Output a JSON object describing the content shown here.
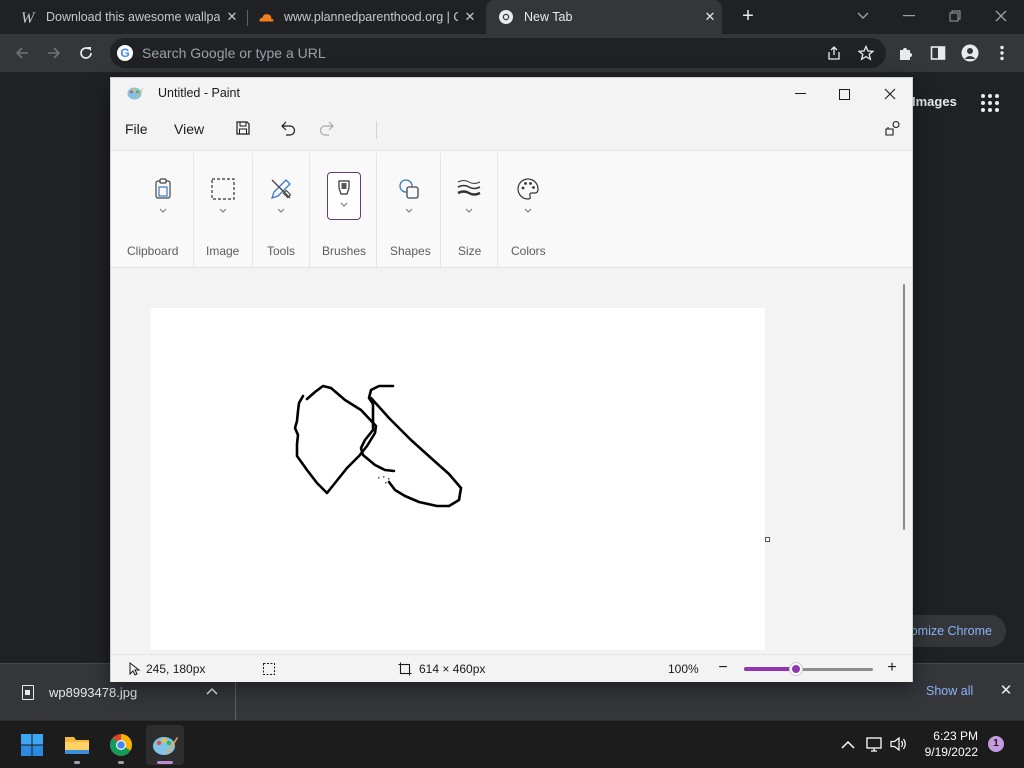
{
  "chrome": {
    "tabs": [
      {
        "title": "Download this awesome wallpap",
        "icon": "wallpaper-site-icon"
      },
      {
        "title": "www.plannedparenthood.org | C",
        "icon": "cloudflare-icon"
      },
      {
        "title": "New Tab",
        "icon": "chrome-icon"
      }
    ],
    "omnibox_placeholder": "Search Google or type a URL",
    "page": {
      "images_link": "Images",
      "customize_label": "Customize Chrome"
    },
    "download_bar": {
      "file_name": "wp8993478.jpg",
      "show_all": "Show all"
    }
  },
  "paint": {
    "title": "Untitled - Paint",
    "menu": {
      "file": "File",
      "view": "View"
    },
    "ribbon": [
      "Clipboard",
      "Image",
      "Tools",
      "Brushes",
      "Shapes",
      "Size",
      "Colors"
    ],
    "status": {
      "cursor_position": "245, 180px",
      "canvas_size": "614 × 460px",
      "zoom": "100%",
      "zoom_level": 0.4
    },
    "colors": {
      "accent": "#9036b0",
      "stroke": "#000000"
    }
  },
  "taskbar": {
    "time": "6:23 PM",
    "date": "9/19/2022",
    "notifications": "1"
  }
}
